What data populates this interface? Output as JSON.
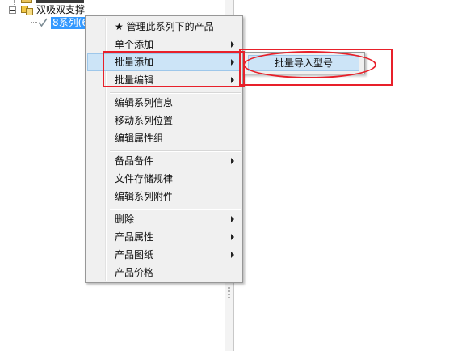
{
  "tree": {
    "parent_label": "双吸双支撑",
    "child_label": "8系列(6"
  },
  "context_menu": {
    "items": [
      {
        "label": "★ 管理此系列下的产品",
        "has_submenu": false
      },
      {
        "label": "单个添加",
        "has_submenu": true
      },
      {
        "label": "批量添加",
        "has_submenu": true,
        "highlighted": true
      },
      {
        "label": "批量编辑",
        "has_submenu": true
      },
      {
        "label": "编辑系列信息",
        "has_submenu": false
      },
      {
        "label": "移动系列位置",
        "has_submenu": false
      },
      {
        "label": "编辑属性组",
        "has_submenu": false
      },
      {
        "label": "备品备件",
        "has_submenu": true
      },
      {
        "label": "文件存储规律",
        "has_submenu": false
      },
      {
        "label": "编辑系列附件",
        "has_submenu": false
      },
      {
        "label": "删除",
        "has_submenu": true
      },
      {
        "label": "产品属性",
        "has_submenu": true
      },
      {
        "label": "产品图纸",
        "has_submenu": true
      },
      {
        "label": "产品价格",
        "has_submenu": false
      }
    ]
  },
  "submenu": {
    "items": [
      {
        "label": "批量导入型号",
        "highlighted": true
      }
    ]
  },
  "colors": {
    "selection_blue": "#3399ff",
    "menu_highlight": "#cce4f7",
    "annotation_red": "#e8202a"
  }
}
